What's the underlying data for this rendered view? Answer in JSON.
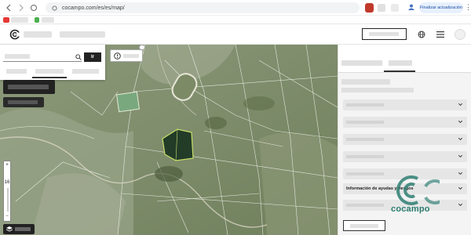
{
  "browser": {
    "url": "cocampo.com/es/es/map/",
    "update_label": "Finalizar actualización",
    "menu_glyph": "⋮"
  },
  "search": {
    "go_label": "Ir"
  },
  "map": {
    "zoom_in": "+",
    "zoom_level": "16",
    "zoom_out": "−"
  },
  "panel": {
    "accordion_aid_label": "Información de ayudas y riesgos"
  },
  "brand": {
    "watermark_text": "cocampo",
    "accent": "#2f7f73"
  },
  "icons": {
    "search": "search-icon",
    "info": "info-icon",
    "globe": "globe-icon",
    "menu": "menu-icon",
    "chevron": "chevron-down-icon",
    "layers": "layers-icon"
  }
}
